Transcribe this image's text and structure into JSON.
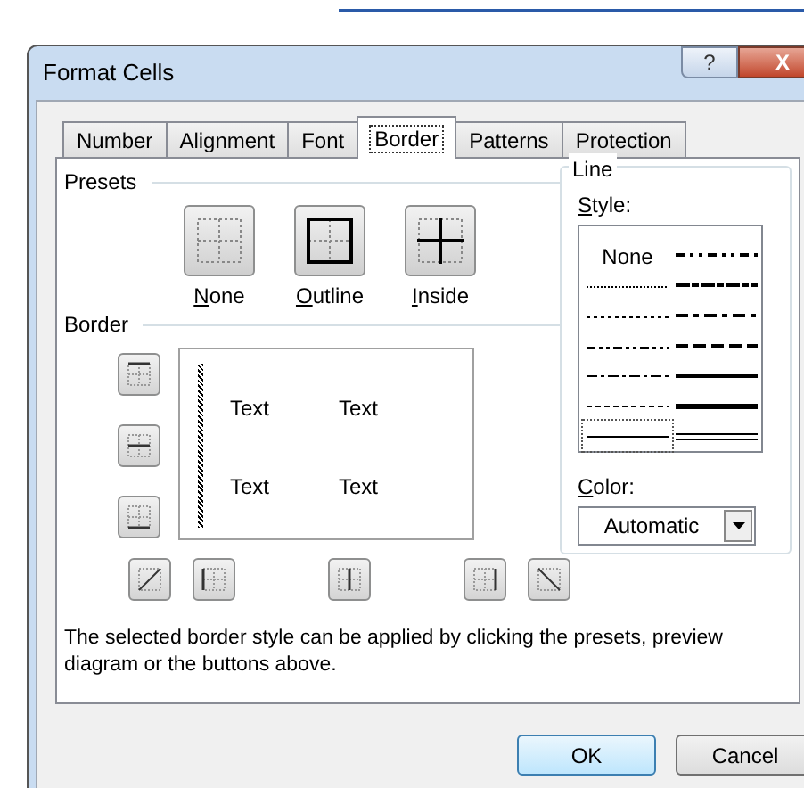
{
  "window": {
    "title": "Format Cells",
    "help_button": "?",
    "close_button": "X"
  },
  "tabs": [
    {
      "label": "Number",
      "selected": false
    },
    {
      "label": "Alignment",
      "selected": false
    },
    {
      "label": "Font",
      "selected": false
    },
    {
      "label": "Border",
      "selected": true
    },
    {
      "label": "Patterns",
      "selected": false
    },
    {
      "label": "Protection",
      "selected": false
    }
  ],
  "presets": {
    "title": "Presets",
    "items": [
      {
        "label": "None",
        "kind": "none",
        "mnemonic": true
      },
      {
        "label": "Outline",
        "kind": "outline",
        "mnemonic": true
      },
      {
        "label": "Inside",
        "kind": "inside",
        "mnemonic": true
      }
    ]
  },
  "border": {
    "title": "Border",
    "left_buttons": [
      {
        "kind": "top"
      },
      {
        "kind": "middle"
      },
      {
        "kind": "bottom"
      }
    ],
    "bottom_buttons": [
      {
        "kind": "diag-up"
      },
      {
        "kind": "left"
      },
      {
        "kind": "vertical"
      },
      {
        "kind": "right"
      },
      {
        "kind": "diag-down"
      }
    ],
    "preview_texts": [
      "Text",
      "Text",
      "Text",
      "Text"
    ],
    "left_border_applied": true
  },
  "line": {
    "title": "Line",
    "style_label": "Style:",
    "style_mnemonic": true,
    "styles": [
      {
        "kind": "none",
        "label": "None",
        "selected": false
      },
      {
        "kind": "hair",
        "selected": false
      },
      {
        "kind": "dotted",
        "selected": false
      },
      {
        "kind": "dash-dot-dot",
        "selected": false
      },
      {
        "kind": "dash-dot",
        "selected": false
      },
      {
        "kind": "dashed",
        "selected": false
      },
      {
        "kind": "thin",
        "selected": true
      },
      {
        "kind": "medium-dash-dot-dot",
        "selected": false
      },
      {
        "kind": "slanted",
        "selected": false
      },
      {
        "kind": "medium-dash-dot",
        "selected": false
      },
      {
        "kind": "medium-dashed",
        "selected": false
      },
      {
        "kind": "medium",
        "selected": false
      },
      {
        "kind": "thick",
        "selected": false
      },
      {
        "kind": "double",
        "selected": false
      }
    ],
    "color_label": "Color:",
    "color_mnemonic": true,
    "color_value": "Automatic"
  },
  "hint": "The selected border style can be applied by clicking the presets, preview diagram or the buttons above.",
  "buttons": [
    {
      "label": "OK",
      "default": true
    },
    {
      "label": "Cancel",
      "default": false
    }
  ]
}
